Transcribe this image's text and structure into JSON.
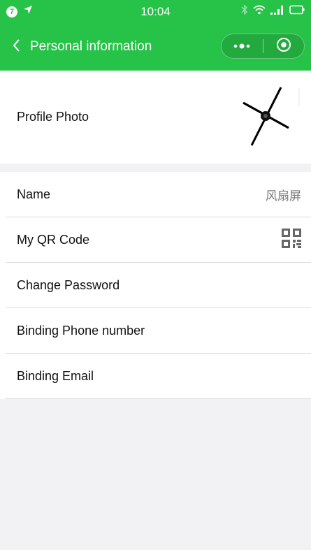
{
  "status_bar": {
    "notification_count": "7",
    "time": "10:04"
  },
  "header": {
    "title": "Personal information"
  },
  "profile": {
    "label": "Profile Photo"
  },
  "rows": [
    {
      "label": "Name",
      "value": "风扇屏"
    },
    {
      "label": "My QR Code"
    },
    {
      "label": "Change Password"
    },
    {
      "label": "Binding Phone number"
    },
    {
      "label": "Binding Email"
    }
  ],
  "colors": {
    "brand": "#27c248",
    "background": "#f2f2f5"
  }
}
